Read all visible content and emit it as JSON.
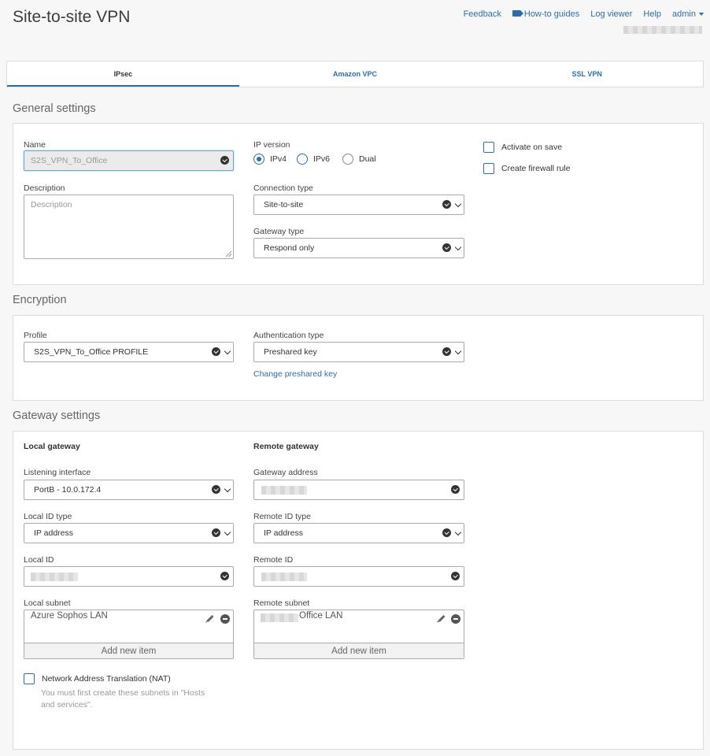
{
  "page": {
    "title": "Site-to-site VPN"
  },
  "topnav": {
    "feedback": "Feedback",
    "howto": "How-to guides",
    "logviewer": "Log viewer",
    "help": "Help",
    "user": "admin"
  },
  "tabs": [
    {
      "label": "IPsec",
      "active": true
    },
    {
      "label": "Amazon VPC"
    },
    {
      "label": "SSL VPN"
    }
  ],
  "general": {
    "section_title": "General settings",
    "name_label": "Name",
    "name_value": "S2S_VPN_To_Office",
    "description_label": "Description",
    "description_placeholder": "Description",
    "ip_version_label": "IP version",
    "ip_options": [
      "IPv4",
      "IPv6",
      "Dual"
    ],
    "ip_selected": "IPv4",
    "connection_type_label": "Connection type",
    "connection_type_value": "Site-to-site",
    "gateway_type_label": "Gateway type",
    "gateway_type_value": "Respond only",
    "activate_on_save": "Activate on save",
    "create_firewall_rule": "Create firewall rule"
  },
  "encryption": {
    "section_title": "Encryption",
    "profile_label": "Profile",
    "profile_value": "S2S_VPN_To_Office PROFILE",
    "auth_type_label": "Authentication type",
    "auth_type_value": "Preshared key",
    "change_key_link": "Change preshared key"
  },
  "gateway": {
    "section_title": "Gateway settings",
    "local_heading": "Local gateway",
    "remote_heading": "Remote gateway",
    "listening_interface_label": "Listening interface",
    "listening_interface_value": "PortB - 10.0.172.4",
    "gateway_address_label": "Gateway address",
    "local_id_type_label": "Local ID type",
    "local_id_type_value": "IP address",
    "remote_id_type_label": "Remote ID type",
    "remote_id_type_value": "IP address",
    "local_id_label": "Local ID",
    "remote_id_label": "Remote ID",
    "local_subnet_label": "Local subnet",
    "local_subnet_item": "Azure Sophos LAN",
    "remote_subnet_label": "Remote subnet",
    "remote_subnet_item": "Office LAN",
    "add_new_item": "Add new item",
    "nat_label": "Network Address Translation (NAT)",
    "nat_hint_line1": "You must first create these subnets in \"Hosts",
    "nat_hint_line2": "and services\"."
  },
  "colors": {
    "accent": "#2d6ea8",
    "background": "#f7f7f7",
    "panel": "#ffffff"
  }
}
